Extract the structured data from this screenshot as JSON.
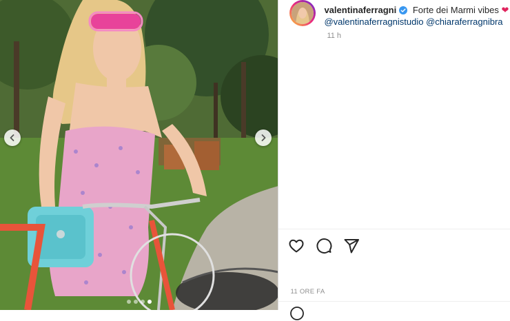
{
  "post": {
    "username": "valentinaferragni",
    "caption_text": "Forte dei Marmi vibes",
    "caption_emoji": "❤",
    "mentions": "@valentinaferragnistudio @chiaraferragnibra",
    "time": "11 h",
    "time_ago": "11 ORE FA"
  },
  "carousel": {
    "slide_count": 4,
    "active_slide": 4
  },
  "icons": {
    "prev": "chevron-left-icon",
    "next": "chevron-right-icon",
    "like": "heart-icon",
    "comment": "comment-icon",
    "share": "paper-plane-icon",
    "verified": "verified-badge-icon",
    "emoji": "emoji-icon"
  },
  "colors": {
    "verified": "#3897f0",
    "mention": "#00376b",
    "muted": "#8e8e8e"
  }
}
